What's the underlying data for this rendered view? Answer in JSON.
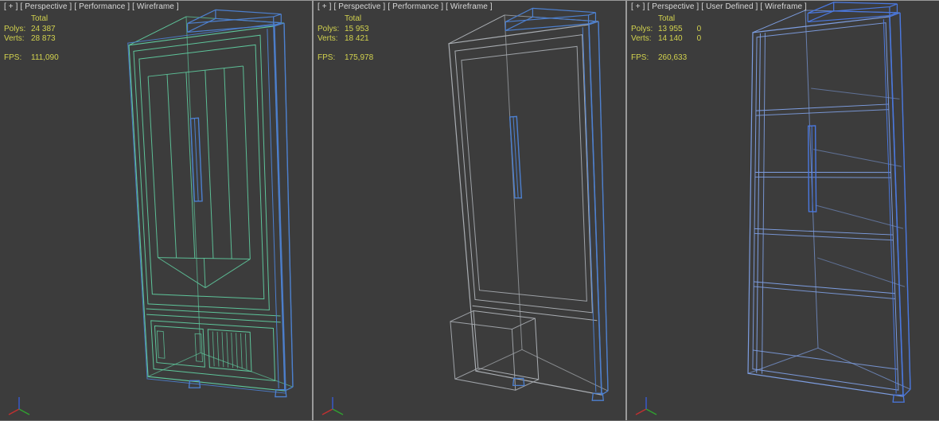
{
  "colors": {
    "background": "#3c3c3c",
    "divider": "#9a9a9a",
    "label_text": "#d8d8d8",
    "stats_text": "#d2d24e"
  },
  "axis": {
    "x": "#c03030",
    "y": "#30a030",
    "z": "#3858c8"
  },
  "viewports": [
    {
      "label": {
        "plus": "[ + ]",
        "pov": "[ Perspective ]",
        "mode": "[ Performance ]",
        "shading": "[ Wireframe ]"
      },
      "stats": {
        "total": "Total",
        "polys_label": "Polys:",
        "polys": "24 387",
        "verts_label": "Verts:",
        "verts": "28 873",
        "fps_label": "FPS:",
        "fps": "111,090"
      },
      "colors": {
        "wire": "#5ec49a",
        "accent": "#4d80d0"
      }
    },
    {
      "label": {
        "plus": "[ + ]",
        "pov": "[ Perspective ]",
        "mode": "[ Performance ]",
        "shading": "[ Wireframe ]"
      },
      "stats": {
        "total": "Total",
        "polys_label": "Polys:",
        "polys": "15 953",
        "verts_label": "Verts:",
        "verts": "18 421",
        "fps_label": "FPS:",
        "fps": "175,978"
      },
      "colors": {
        "wire": "#a9adb2",
        "accent": "#4d80d0"
      }
    },
    {
      "label": {
        "plus": "[ + ]",
        "pov": "[ Perspective ]",
        "mode": "[ User Defined ]",
        "shading": "[ Wireframe ]"
      },
      "stats": {
        "total": "Total",
        "polys_label": "Polys:",
        "polys": "13 955",
        "polys_sel": "0",
        "verts_label": "Verts:",
        "verts": "14 140",
        "verts_sel": "0",
        "fps_label": "FPS:",
        "fps": "260,633"
      },
      "colors": {
        "wire": "#7d9de0",
        "accent": "#4a78e0"
      }
    }
  ]
}
